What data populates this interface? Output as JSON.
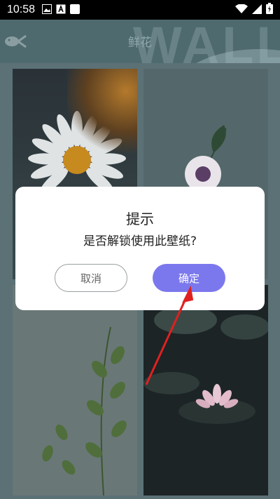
{
  "status_bar": {
    "time": "10:58"
  },
  "app_bar": {
    "title": "鲜花",
    "watermark": "WALL"
  },
  "dialog": {
    "title": "提示",
    "message": "是否解锁使用此壁纸?",
    "cancel_label": "取消",
    "confirm_label": "确定"
  },
  "colors": {
    "confirm": "#7b78ee",
    "annotation": "#e02020"
  }
}
